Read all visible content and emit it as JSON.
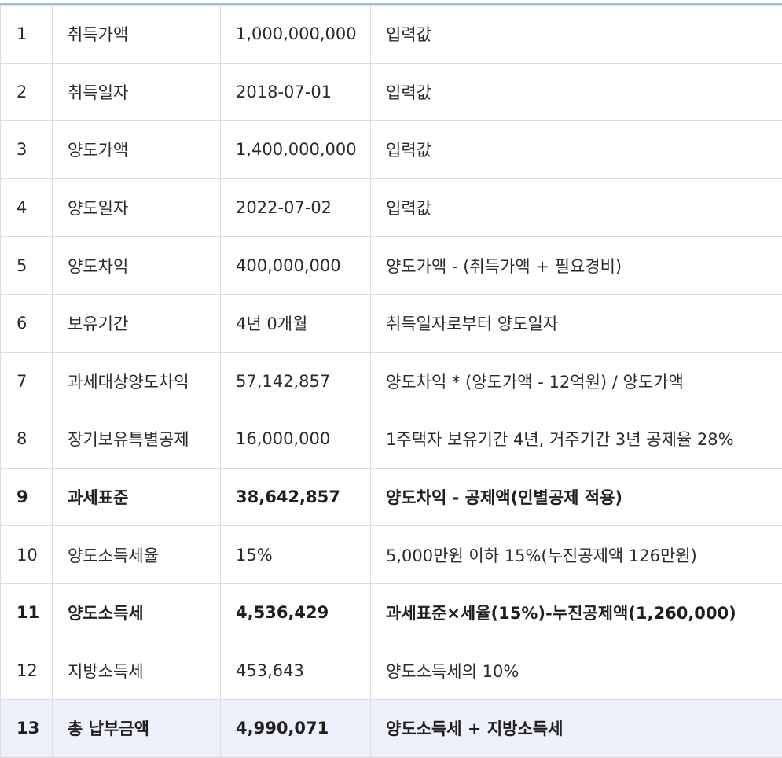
{
  "rows": [
    {
      "no": "1",
      "item": "취득가액",
      "amount": "1,000,000,000",
      "note": "입력값",
      "bold": false,
      "highlight": false
    },
    {
      "no": "2",
      "item": "취득일자",
      "amount": "2018-07-01",
      "note": "입력값",
      "bold": false,
      "highlight": false
    },
    {
      "no": "3",
      "item": "양도가액",
      "amount": "1,400,000,000",
      "note": "입력값",
      "bold": false,
      "highlight": false
    },
    {
      "no": "4",
      "item": "양도일자",
      "amount": "2022-07-02",
      "note": "입력값",
      "bold": false,
      "highlight": false
    },
    {
      "no": "5",
      "item": "양도차익",
      "amount": "400,000,000",
      "note": "양도가액 - (취득가액 + 필요경비)",
      "bold": false,
      "highlight": false
    },
    {
      "no": "6",
      "item": "보유기간",
      "amount": "4년 0개월",
      "note": "취득일자로부터 양도일자",
      "bold": false,
      "highlight": false
    },
    {
      "no": "7",
      "item": "과세대상양도차익",
      "amount": "57,142,857",
      "note": "양도차익 * (양도가액 - 12억원) / 양도가액",
      "bold": false,
      "highlight": false
    },
    {
      "no": "8",
      "item": "장기보유특별공제",
      "amount": "16,000,000",
      "note": "1주택자 보유기간 4년, 거주기간 3년 공제율 28%",
      "bold": false,
      "highlight": false
    },
    {
      "no": "9",
      "item": "과세표준",
      "amount": "38,642,857",
      "note": "양도차익 - 공제액(인별공제 적용)",
      "bold": true,
      "highlight": false
    },
    {
      "no": "10",
      "item": "양도소득세율",
      "amount": "15%",
      "note": "5,000만원 이하 15%(누진공제액 126만원)",
      "bold": false,
      "highlight": false
    },
    {
      "no": "11",
      "item": "양도소득세",
      "amount": "4,536,429",
      "note": "과세표준×세율(15%)-누진공제액(1,260,000)",
      "bold": true,
      "highlight": false
    },
    {
      "no": "12",
      "item": "지방소득세",
      "amount": "453,643",
      "note": "양도소득세의 10%",
      "bold": false,
      "highlight": false
    },
    {
      "no": "13",
      "item": "총 납부금액",
      "amount": "4,990,071",
      "note": "양도소득세 + 지방소득세",
      "bold": true,
      "highlight": true
    }
  ]
}
